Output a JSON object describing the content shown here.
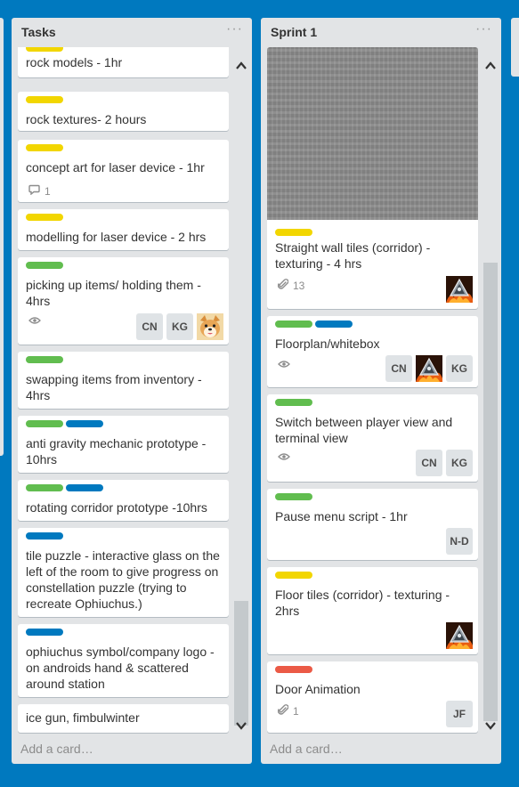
{
  "board": {
    "lists": [
      {
        "title": "Tasks",
        "add_card": "Add a card…",
        "cards": [
          {
            "labels": [
              "yellow"
            ],
            "title": "rock models - 1hr"
          },
          {
            "labels": [
              "yellow"
            ],
            "title": "rock textures- 2 hours"
          },
          {
            "labels": [
              "yellow"
            ],
            "title": "concept art for laser device - 1hr",
            "comments": "1"
          },
          {
            "labels": [
              "yellow"
            ],
            "title": "modelling for laser device - 2 hrs"
          },
          {
            "labels": [
              "green"
            ],
            "title": "picking up items/ holding them - 4hrs",
            "watch": true,
            "members": [
              "CN",
              "KG",
              "avatar-dog"
            ]
          },
          {
            "labels": [
              "green"
            ],
            "title": "swapping items from inventory - 4hrs"
          },
          {
            "labels": [
              "green",
              "blue"
            ],
            "title": "anti gravity mechanic prototype - 10hrs"
          },
          {
            "labels": [
              "green",
              "blue"
            ],
            "title": "rotating corridor prototype -10hrs"
          },
          {
            "labels": [
              "blue"
            ],
            "title": "tile puzzle - interactive glass on the left of the room to give progress on constellation puzzle (trying to recreate Ophiuchus.)"
          },
          {
            "labels": [
              "blue"
            ],
            "title": "ophiuchus symbol/company logo - on androids hand & scattered around station"
          },
          {
            "labels": [],
            "title": "ice gun, fimbulwinter"
          }
        ]
      },
      {
        "title": "Sprint 1",
        "add_card": "Add a card…",
        "cards": [
          {
            "cover": true,
            "labels": [
              "yellow"
            ],
            "title": "Straight wall tiles (corridor) - texturing - 4 hrs",
            "attachments": "13",
            "members": [
              "avatar-fire"
            ]
          },
          {
            "labels": [
              "green",
              "blue"
            ],
            "title": "Floorplan/whitebox",
            "watch": true,
            "members": [
              "CN",
              "avatar-fire",
              "KG"
            ]
          },
          {
            "labels": [
              "green"
            ],
            "title": "Switch between player view and terminal view",
            "watch": true,
            "members": [
              "CN",
              "KG"
            ]
          },
          {
            "labels": [
              "green"
            ],
            "title": "Pause menu script - 1hr",
            "members": [
              "N-D"
            ]
          },
          {
            "labels": [
              "yellow"
            ],
            "title": "Floor tiles (corridor) - texturing - 2hrs",
            "members": [
              "avatar-fire"
            ]
          },
          {
            "labels": [
              "red"
            ],
            "title": "Door Animation",
            "attachments": "1",
            "members": [
              "JF"
            ]
          }
        ]
      }
    ]
  },
  "colors": {
    "board_bg": "#0079bf",
    "list_bg": "#e2e4e6",
    "yellow": "#f2d600",
    "green": "#61bd4f",
    "blue": "#0079bf",
    "red": "#eb5a46"
  },
  "icons": {
    "list_menu": "ellipsis-icon",
    "scroll_up": "chevron-up-icon",
    "scroll_down": "chevron-down-icon",
    "comments": "comment-icon",
    "watch": "eye-icon",
    "attachments": "paperclip-icon"
  }
}
